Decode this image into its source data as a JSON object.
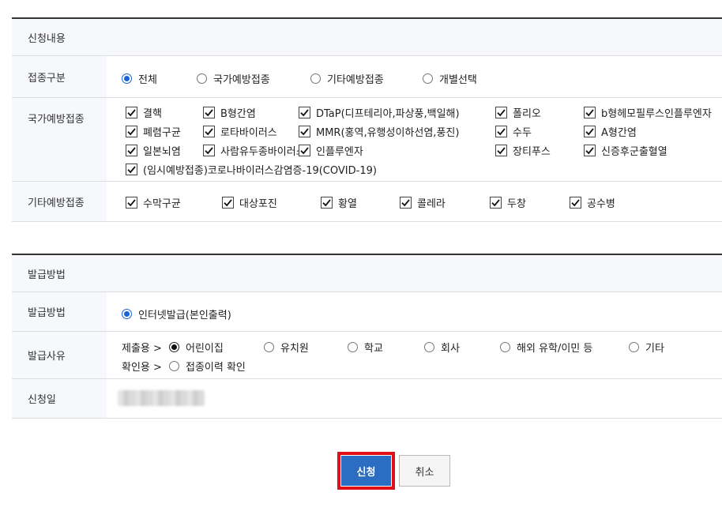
{
  "apply_section": {
    "title": "신청내용",
    "category": {
      "label": "접종구분",
      "options": [
        "전체",
        "국가예방접종",
        "기타예방접종",
        "개별선택"
      ],
      "selected": "전체"
    },
    "national": {
      "label": "국가예방접종",
      "items": [
        "결핵",
        "B형간염",
        "DTaP(디프테리아,파상풍,백일해)",
        "폴리오",
        "b형헤모필루스인플루엔자",
        "폐렴구균",
        "로타바이러스",
        "MMR(홍역,유행성이하선염,풍진)",
        "수두",
        "A형간염",
        "일본뇌염",
        "사람유두종바이러스",
        "인플루엔자",
        "장티푸스",
        "신증후군출혈열",
        "(임시예방접종)코로나바이러스감염증-19(COVID-19)"
      ]
    },
    "other": {
      "label": "기타예방접종",
      "items": [
        "수막구균",
        "대상포진",
        "황열",
        "콜레라",
        "두창",
        "공수병"
      ]
    }
  },
  "issue_section": {
    "title": "발급방법",
    "method": {
      "label": "발급방법",
      "option": "인터넷발급(본인출력)"
    },
    "reason": {
      "label": "발급사유",
      "submit_prefix": "제출용 >",
      "submit_options": [
        "어린이집",
        "유치원",
        "학교",
        "회사",
        "해외 유학/이민 등",
        "기타"
      ],
      "selected": "어린이집",
      "confirm_prefix": "확인용 >",
      "confirm_option": "접종이력 확인"
    },
    "date": {
      "label": "신청일"
    }
  },
  "buttons": {
    "apply": "신청",
    "cancel": "취소"
  },
  "colors": {
    "primary": "#2b6dc0",
    "highlight": "#e01018",
    "radio_on": "#1a63d6"
  }
}
